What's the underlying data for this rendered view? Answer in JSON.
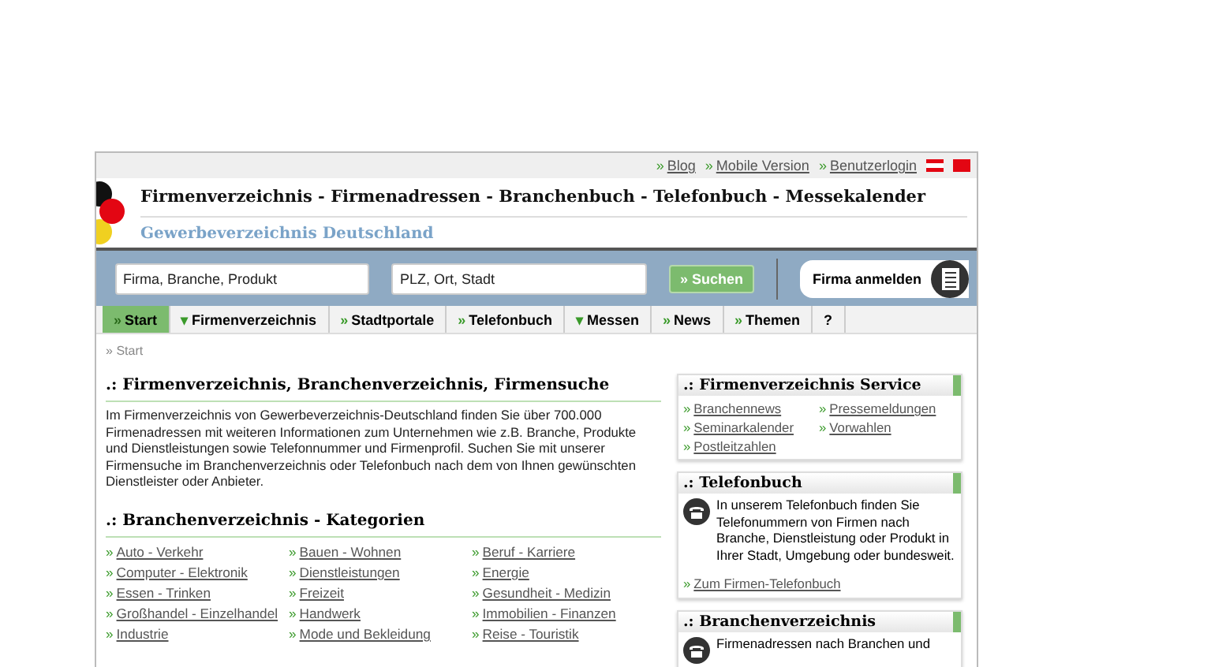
{
  "top_links": [
    {
      "marker": "»",
      "label": "Blog"
    },
    {
      "marker": "»",
      "label": "Mobile Version"
    },
    {
      "marker": "»",
      "label": "Benutzerlogin"
    }
  ],
  "header": {
    "title": "Firmenverzeichnis - Firmenadressen - Branchenbuch - Telefonbuch - Messekalender",
    "subtitle": "Gewerbeverzeichnis Deutschland"
  },
  "search": {
    "what_placeholder": "Firma, Branche, Produkt",
    "where_placeholder": "PLZ, Ort, Stadt",
    "button": {
      "marker": "»",
      "label": "Suchen"
    },
    "register": "Firma anmelden"
  },
  "tabs": [
    {
      "marker": "»",
      "label": "Start",
      "selected": true
    },
    {
      "marker": "▾",
      "label": "Firmenverzeichnis",
      "selected": false
    },
    {
      "marker": "»",
      "label": "Stadtportale",
      "selected": false
    },
    {
      "marker": "»",
      "label": "Telefonbuch",
      "selected": false
    },
    {
      "marker": "▾",
      "label": "Messen",
      "selected": false
    },
    {
      "marker": "»",
      "label": "News",
      "selected": false
    },
    {
      "marker": "»",
      "label": "Themen",
      "selected": false
    },
    {
      "label": "?",
      "selected": false
    }
  ],
  "breadcrumb": {
    "marker": "»",
    "label": "Start"
  },
  "intro": {
    "heading": ".: Firmenverzeichnis, Branchenverzeichnis, Firmensuche",
    "text": "Im Firmenverzeichnis von Gewerbeverzeichnis-Deutschland finden Sie über 700.000 Firmenadressen mit weiteren Informationen zum Unternehmen wie z.B. Branche, Produkte und Dienstleistungen sowie Telefonnummer und Firmenprofil. Suchen Sie mit unserer Firmensuche im Branchenverzeichnis oder Telefonbuch nach dem von Ihnen gewünschten Dienstleister oder Anbieter."
  },
  "categories": {
    "heading": ".: Branchenverzeichnis - Kategorien",
    "items": [
      {
        "marker": "»",
        "label": "Auto - Verkehr"
      },
      {
        "marker": "»",
        "label": "Bauen - Wohnen"
      },
      {
        "marker": "»",
        "label": "Beruf - Karriere"
      },
      {
        "marker": "»",
        "label": "Computer - Elektronik"
      },
      {
        "marker": "»",
        "label": "Dienstleistungen"
      },
      {
        "marker": "»",
        "label": "Energie"
      },
      {
        "marker": "»",
        "label": "Essen - Trinken"
      },
      {
        "marker": "»",
        "label": "Freizeit"
      },
      {
        "marker": "»",
        "label": "Gesundheit - Medizin"
      },
      {
        "marker": "»",
        "label": "Großhandel - Einzelhandel"
      },
      {
        "marker": "»",
        "label": "Handwerk"
      },
      {
        "marker": "»",
        "label": "Immobilien - Finanzen"
      },
      {
        "marker": "»",
        "label": "Industrie"
      },
      {
        "marker": "»",
        "label": "Mode und Bekleidung"
      },
      {
        "marker": "»",
        "label": "Reise - Touristik"
      }
    ]
  },
  "sidebar": [
    {
      "kind": "links",
      "title": ".: Firmenverzeichnis Service",
      "links": [
        {
          "marker": "»",
          "label": "Branchennews"
        },
        {
          "marker": "»",
          "label": "Pressemeldungen"
        },
        {
          "marker": "»",
          "label": "Seminarkalender"
        },
        {
          "marker": "»",
          "label": "Vorwahlen"
        },
        {
          "marker": "»",
          "label": "Postleitzahlen"
        }
      ]
    },
    {
      "kind": "phone",
      "title": ".: Telefonbuch",
      "text": "In unserem Telefonbuch finden Sie Telefonummern von Firmen nach Branche, Dienstleistung oder Produkt in Ihrer Stadt, Umgebung oder bundesweit.",
      "links": [
        {
          "marker": "»",
          "label": "Zum Firmen-Telefonbuch"
        }
      ]
    },
    {
      "kind": "phone",
      "title": ".: Branchenverzeichnis",
      "text": "Firmenadressen nach Branchen und"
    }
  ]
}
